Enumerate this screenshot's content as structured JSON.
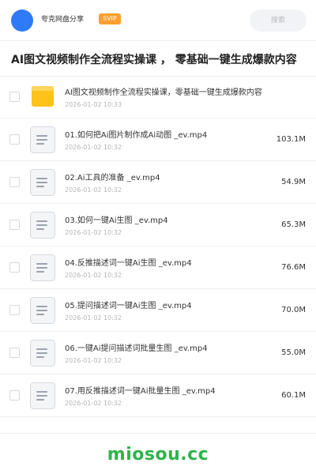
{
  "header": {
    "share_title": "夸克网盘分享",
    "badge": "SVIP",
    "search_placeholder": "搜索"
  },
  "title": "AI图文视频制作全流程实操课 ， 零基础一键生成爆款内容",
  "files": [
    {
      "type": "folder",
      "name": "AI图文视频制作全流程实操课，零基础一键生成爆款内容",
      "date": "2026-01-02 10:33",
      "size": ""
    },
    {
      "type": "file",
      "name": "01.如何把Ai图片制作成Ai动图 _ev.mp4",
      "date": "2026-01-02 10:32",
      "size": "103.1M"
    },
    {
      "type": "file",
      "name": "02.Ai工具的准备 _ev.mp4",
      "date": "2026-01-02 10:32",
      "size": "54.9M"
    },
    {
      "type": "file",
      "name": "03.如何一键Ai生图 _ev.mp4",
      "date": "2026-01-02 10:32",
      "size": "65.3M"
    },
    {
      "type": "file",
      "name": "04.反推描述词一键Ai生图 _ev.mp4",
      "date": "2026-01-02 10:32",
      "size": "76.6M"
    },
    {
      "type": "file",
      "name": "05.提问描述词一键Ai生图 _ev.mp4",
      "date": "2026-01-02 10:32",
      "size": "70.0M"
    },
    {
      "type": "file",
      "name": "06.一键Ai提问描述词批量生图 _ev.mp4",
      "date": "2026-01-02 10:32",
      "size": "55.0M"
    },
    {
      "type": "file",
      "name": "07.用反推描述词一键Ai批量生图 _ev.mp4",
      "date": "2026-01-02 10:32",
      "size": "60.1M"
    }
  ],
  "watermark": "miosou.cc",
  "colors": {
    "avatar": "#2f7af6",
    "badge": "#ff9f2b",
    "folder": "#ffc21a",
    "watermark": "#2fb34a"
  }
}
